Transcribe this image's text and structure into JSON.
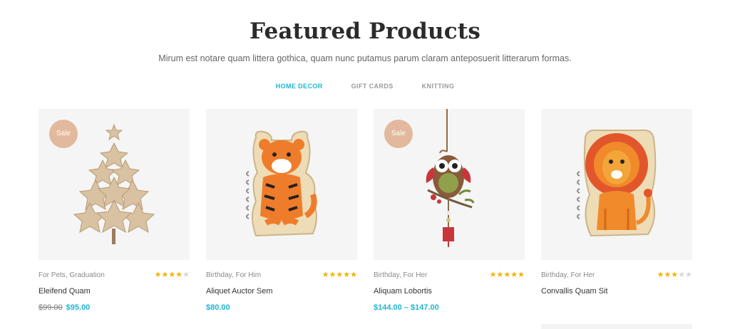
{
  "header": {
    "title": "Featured Products",
    "subtitle": "Mirum est notare quam littera gothica, quam nunc putamus parum claram anteposuerit litterarum formas."
  },
  "tabs": [
    {
      "label": "HOME DECOR",
      "active": true
    },
    {
      "label": "GIFT CARDS",
      "active": false
    },
    {
      "label": "KNITTING",
      "active": false
    }
  ],
  "products": [
    {
      "categories": "For Pets, Graduation",
      "name": "Eleifend Quam",
      "old_price": "$99.00",
      "price": "$95.00",
      "rating": 4,
      "badge": "Sale",
      "image": "star-tree-ornament"
    },
    {
      "categories": "Birthday, For Him",
      "name": "Aliquet Auctor Sem",
      "old_price": "",
      "price": "$80.00",
      "rating": 5,
      "badge": "",
      "image": "tiger-notebook"
    },
    {
      "categories": "Birthday, For Her",
      "name": "Aliquam Lobortis",
      "old_price": "",
      "price": "$144.00 – $147.00",
      "rating": 5,
      "badge": "Sale",
      "image": "owl-ornament"
    },
    {
      "categories": "Birthday, For Her",
      "name": "Convallis Quam Sit",
      "old_price": "",
      "price": "",
      "rating": 3,
      "badge": "",
      "image": "lion-notebook"
    }
  ],
  "colors": {
    "accent": "#1fb6d4",
    "sale_badge": "#e2b99c",
    "star": "#f2b300",
    "star_off": "#d6d6d6"
  }
}
